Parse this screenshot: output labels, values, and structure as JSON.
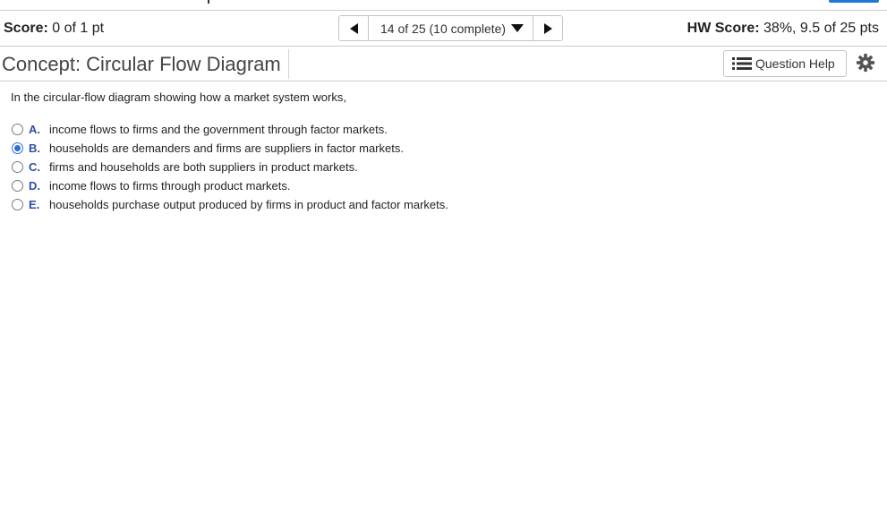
{
  "score": {
    "label": "Score:",
    "value": "0 of 1 pt"
  },
  "navigation": {
    "position": "14 of 25 (10 complete)"
  },
  "hw_score": {
    "label": "HW Score:",
    "value": "38%, 9.5 of 25 pts"
  },
  "title": "Concept: Circular Flow Diagram",
  "question_help": {
    "label": "Question Help"
  },
  "question": {
    "stem": "In the circular-flow diagram showing how a market system works,",
    "options": [
      {
        "letter": "A.",
        "text": "income flows to firms and the government through factor markets.",
        "selected": false
      },
      {
        "letter": "B.",
        "text": "households are demanders and firms are suppliers in factor markets.",
        "selected": true
      },
      {
        "letter": "C.",
        "text": "firms and households are both suppliers in product markets.",
        "selected": false
      },
      {
        "letter": "D.",
        "text": "income flows to firms through product markets.",
        "selected": false
      },
      {
        "letter": "E.",
        "text": "households purchase output produced by firms in product and factor markets.",
        "selected": false
      }
    ]
  },
  "icons": {
    "prev": "triangle-left-icon",
    "next": "triangle-right-icon",
    "dropdown": "caret-down-icon",
    "help": "list-icon",
    "settings": "gear-icon"
  },
  "colors": {
    "accent": "#2d6fd6",
    "option_letter": "#2c4fa3",
    "top_tab": "#1f78d1"
  }
}
